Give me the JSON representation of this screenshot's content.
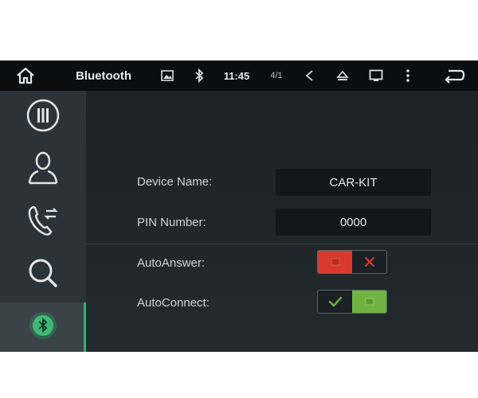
{
  "statusbar": {
    "title": "Bluetooth",
    "time": "11:45",
    "signal": "4/1",
    "icons": [
      "home-icon",
      "image-icon",
      "bluetooth-icon",
      "signal-icon",
      "volume-icon",
      "eject-icon",
      "window-icon",
      "more-icon",
      "back-icon"
    ]
  },
  "sidebar": {
    "items": [
      {
        "name": "dialpad",
        "icon": "dialpad-icon"
      },
      {
        "name": "contacts",
        "icon": "person-icon"
      },
      {
        "name": "call-log",
        "icon": "phone-transfer-icon"
      },
      {
        "name": "search",
        "icon": "search-icon"
      },
      {
        "name": "settings",
        "icon": "bluetooth-icon",
        "active": true
      }
    ]
  },
  "settings": {
    "device_name_label": "Device Name:",
    "device_name_value": "CAR-KIT",
    "pin_label": "PIN Number:",
    "pin_value": "0000",
    "auto_answer_label": "AutoAnswer:",
    "auto_answer_state": "off",
    "auto_connect_label": "AutoConnect:",
    "auto_connect_state": "on"
  },
  "colors": {
    "toggle_off": "#d83a2f",
    "toggle_on": "#6fb342",
    "accent": "#32b06a"
  }
}
